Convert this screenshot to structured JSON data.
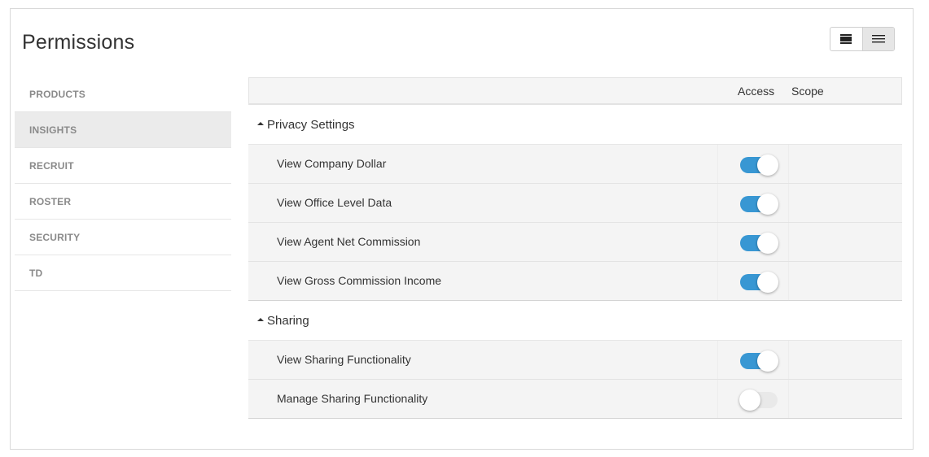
{
  "page": {
    "title": "Permissions"
  },
  "view_toggle": {
    "options": [
      {
        "icon": "block-view-icon",
        "active": false
      },
      {
        "icon": "list-view-icon",
        "active": true
      }
    ]
  },
  "sidebar": {
    "items": [
      {
        "label": "PRODUCTS",
        "active": false
      },
      {
        "label": "INSIGHTS",
        "active": true
      },
      {
        "label": "RECRUIT",
        "active": false
      },
      {
        "label": "ROSTER",
        "active": false
      },
      {
        "label": "SECURITY",
        "active": false
      },
      {
        "label": "TD",
        "active": false
      }
    ]
  },
  "table": {
    "columns": {
      "access": "Access",
      "scope": "Scope"
    },
    "groups": [
      {
        "name": "Privacy Settings",
        "rows": [
          {
            "label": "View Company Dollar",
            "access": true
          },
          {
            "label": "View Office Level Data",
            "access": true
          },
          {
            "label": "View Agent Net Commission",
            "access": true
          },
          {
            "label": "View Gross Commission Income",
            "access": true
          }
        ]
      },
      {
        "name": "Sharing",
        "rows": [
          {
            "label": "View Sharing Functionality",
            "access": true
          },
          {
            "label": "Manage Sharing Functionality",
            "access": false
          }
        ]
      }
    ]
  },
  "colors": {
    "toggle_on": "#3897d3",
    "toggle_off": "#e9e9e9",
    "active_item_bg": "#ebebeb"
  }
}
